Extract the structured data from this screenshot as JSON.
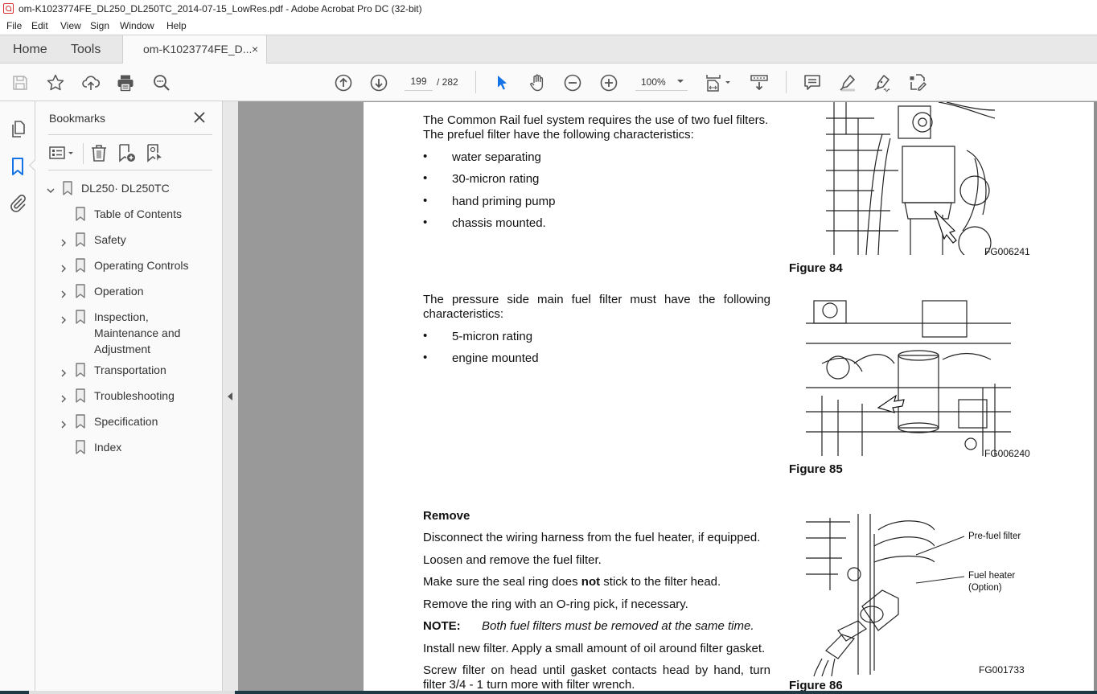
{
  "window": {
    "title": "om-K1023774FE_DL250_DL250TC_2014-07-15_LowRes.pdf - Adobe Acrobat Pro DC (32-bit)",
    "app_icon": "acrobat-icon"
  },
  "menu": [
    "File",
    "Edit",
    "View",
    "Sign",
    "Window",
    "Help"
  ],
  "tabs": {
    "home": "Home",
    "tools": "Tools",
    "document": "om-K1023774FE_D...",
    "close_glyph": "×"
  },
  "toolbar": {
    "left_icons": [
      "save-icon",
      "bookmark-star-icon",
      "upload-cloud-icon",
      "print-icon",
      "find-search-icon"
    ],
    "nav_icons": [
      "page-up-icon",
      "page-down-icon"
    ],
    "current_page": "199",
    "page_total": "/ 282",
    "tool_icons": [
      "select-arrow-icon",
      "hand-tool-icon",
      "zoom-out-icon",
      "zoom-in-icon"
    ],
    "zoom_level": "100%",
    "view_icons": [
      "page-fit-icon",
      "scroll-mode-icon"
    ],
    "annotate_icons": [
      "comment-icon",
      "highlight-icon",
      "sign-icon",
      "edit-pdf-icon"
    ],
    "accent_color": "#1473e6"
  },
  "left_rail": {
    "icons": [
      "page-thumbnails-icon",
      "bookmarks-icon",
      "attachments-icon"
    ],
    "active": "bookmarks-icon"
  },
  "bookmarks": {
    "title": "Bookmarks",
    "close_glyph": "✕",
    "tools": [
      "options-menu-icon",
      "delete-bookmark-icon",
      "new-bookmark-icon",
      "find-current-bookmark-icon"
    ],
    "root": {
      "label": "DL250· DL250TC",
      "expanded": true
    },
    "items": [
      {
        "label": "Table of Contents",
        "expandable": false
      },
      {
        "label": "Safety",
        "expandable": true
      },
      {
        "label": "Operating Controls",
        "expandable": true
      },
      {
        "label": "Operation",
        "expandable": true
      },
      {
        "label": "Inspection,",
        "label2": "Maintenance and",
        "label3": "Adjustment",
        "expandable": true
      },
      {
        "label": "Transportation",
        "expandable": true
      },
      {
        "label": "Troubleshooting",
        "expandable": true
      },
      {
        "label": "Specification",
        "expandable": true
      },
      {
        "label": "Index",
        "expandable": false
      }
    ]
  },
  "document": {
    "para1_line1": "The Common Rail fuel system requires the use of two fuel filters.",
    "para1_line2": "The prefuel filter have the following characteristics:",
    "list1": [
      "water separating",
      "30-micron rating",
      "hand priming pump",
      "chassis mounted."
    ],
    "para2_line1": "The pressure side main fuel filter must have the following",
    "para2_line2": "characteristics:",
    "list2": [
      "5-micron rating",
      "engine mounted"
    ],
    "bullet": "•",
    "remove_heading": "Remove",
    "steps": [
      "Disconnect the wiring harness from the fuel heater, if equipped.",
      "Loosen and remove the fuel filter."
    ],
    "step3_pre": "Make sure the seal ring does ",
    "step3_bold": "not",
    "step3_post": " stick to the filter head.",
    "step4": "Remove the ring with an O-ring pick, if necessary.",
    "note_label": "NOTE:",
    "note_text": "Both fuel filters must be removed at the same time.",
    "step5": "Install new filter. Apply a small amount of oil around filter gasket.",
    "step6_line1": "Screw filter on head until gasket contacts head by hand, turn",
    "step6_line2": "filter 3/4 - 1 turn more with filter wrench.",
    "figures": [
      {
        "label": "Figure 84",
        "code": "FG006241"
      },
      {
        "label": "Figure 85",
        "code": "FG006240"
      },
      {
        "label": "Figure 86",
        "code": "FG001733",
        "callouts": [
          "Pre-fuel filter",
          "Fuel heater",
          "(Option)"
        ]
      }
    ]
  }
}
